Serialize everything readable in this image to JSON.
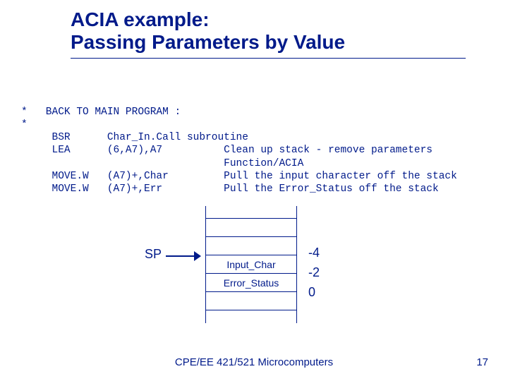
{
  "title_line1": "ACIA example:",
  "title_line2": "Passing Parameters by Value",
  "code": "*   BACK TO MAIN PROGRAM :\n*\n     BSR      Char_In.Call subroutine\n     LEA      (6,A7),A7          Clean up stack - remove parameters\n                                 Function/ACIA\n     MOVE.W   (A7)+,Char         Pull the input character off the stack\n     MOVE.W   (A7)+,Err          Pull the Error_Status off the stack",
  "sp_label": "SP",
  "stack_cells": {
    "c0": "",
    "c1": "",
    "c2": "Input_Char",
    "c3": "Error_Status",
    "c4": ""
  },
  "offsets": {
    "o0": "-4",
    "o1": "-2",
    "o2": "0"
  },
  "footer": "CPE/EE 421/521 Microcomputers",
  "pagenum": "17"
}
